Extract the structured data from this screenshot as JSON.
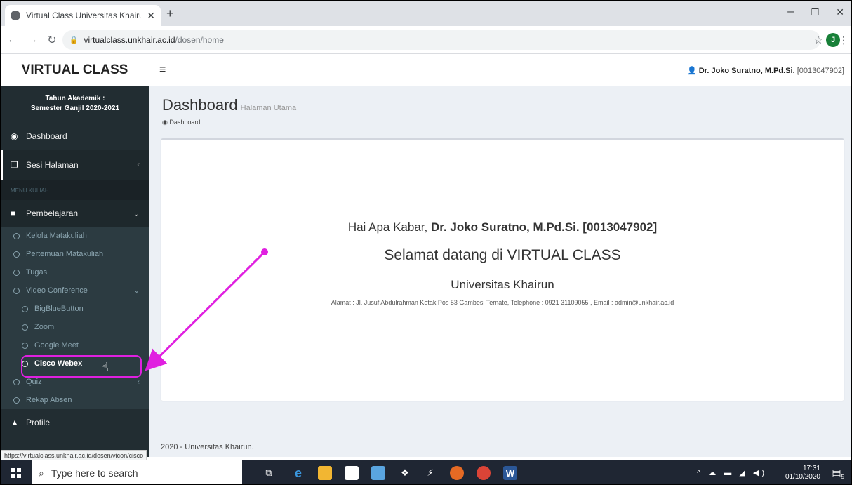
{
  "browser": {
    "tab_title": "Virtual Class Universitas Khairun",
    "tab_close": "✕",
    "new_tab": "+",
    "minimize": "–",
    "restore": "❐",
    "close": "✕",
    "url_host": "virtualclass.unkhair.ac.id",
    "url_path": "/dosen/home",
    "profile_initial": "J",
    "status_link": "https://virtualclass.unkhair.ac.id/dosen/vicon/cisco"
  },
  "header": {
    "brand": "VIRTUAL CLASS",
    "user_name": "Dr. Joko Suratno, M.Pd.Si.",
    "user_nim": "[0013047902]"
  },
  "sidebar": {
    "year_label": "Tahun Akademik :",
    "semester": "Semester Ganjil 2020-2021",
    "dashboard": "Dashboard",
    "sesi": "Sesi Halaman",
    "menu_header": "MENU KULIAH",
    "pembelajaran": "Pembelajaran",
    "items": {
      "kelola": "Kelola Matakuliah",
      "pertemuan": "Pertemuan Matakuliah",
      "tugas": "Tugas",
      "video": "Video Conference",
      "bbb": "BigBlueButton",
      "zoom": "Zoom",
      "meet": "Google Meet",
      "webex": "Cisco Webex",
      "quiz": "Quiz",
      "rekap": "Rekap Absen"
    },
    "profile": "Profile"
  },
  "content": {
    "title": "Dashboard",
    "subtitle": "Halaman Utama",
    "breadcrumb": "Dashboard",
    "greeting_prefix": "Hai Apa Kabar,",
    "greeting_name": "Dr. Joko Suratno, M.Pd.Si. [0013047902]",
    "welcome": "Selamat datang di VIRTUAL CLASS",
    "university": "Universitas Khairun",
    "address": "Alamat : Jl. Jusuf Abdulrahman Kotak Pos 53 Gambesi Ternate, Telephone : 0921 31109055 , Email : admin@unkhair.ac.id",
    "footer": "2020 - Universitas Khairun."
  },
  "taskbar": {
    "search_placeholder": "Type here to search",
    "time": "17:31",
    "date": "01/10/2020",
    "notification_count": "5"
  },
  "colors": {
    "sidebar_bg": "#222d32",
    "highlight": "#e020e0",
    "content_bg": "#ecf0f5"
  }
}
